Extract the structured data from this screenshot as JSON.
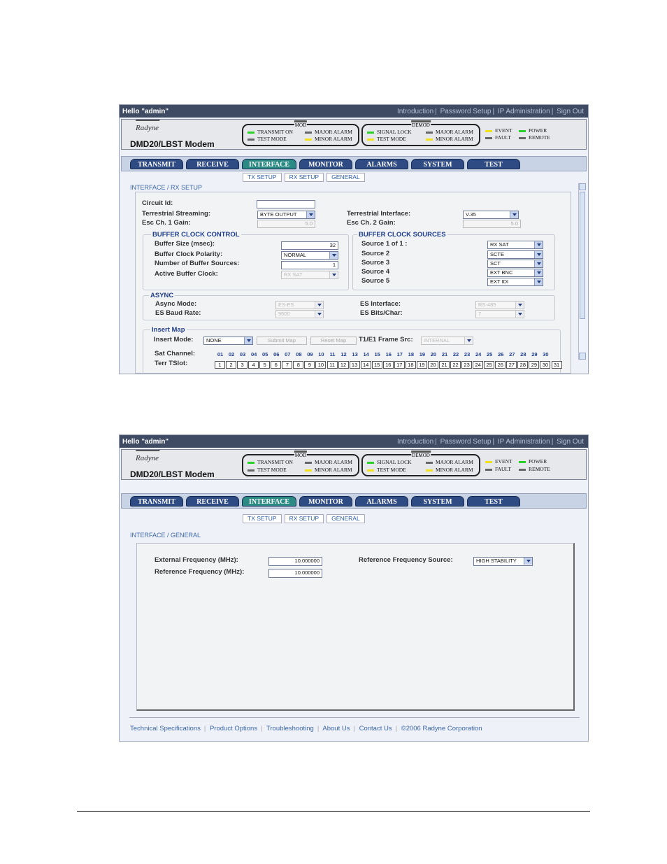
{
  "header": {
    "greeting": "Hello \"admin\"",
    "links": [
      "Introduction",
      "Password Setup",
      "IP Administration",
      "Sign Out"
    ],
    "logo": "RADYNE",
    "model": "DMD20/LBST Modem",
    "mod_label": "MOD",
    "demod_label": "DEMOD",
    "mod_leds": [
      "TRANSMIT ON",
      "TEST MODE",
      "MAJOR ALARM",
      "MINOR ALARM"
    ],
    "demod_leds": [
      "SIGNAL LOCK",
      "TEST MODE",
      "MAJOR ALARM",
      "MINOR ALARM"
    ],
    "sys_leds": [
      "EVENT",
      "FAULT",
      "POWER",
      "REMOTE"
    ],
    "colors": {
      "green": "#2bd12b",
      "yellow": "#f2e21b",
      "gray": "#666666"
    }
  },
  "tabs": [
    "TRANSMIT",
    "RECEIVE",
    "INTERFACE",
    "MONITOR",
    "ALARMS",
    "SYSTEM",
    "TEST"
  ],
  "active_tab": "INTERFACE",
  "subtabs": [
    "TX SETUP",
    "RX SETUP",
    "GENERAL"
  ],
  "screen1": {
    "breadcrumb": "INTERFACE / RX SETUP",
    "circuit_id_label": "Circuit Id:",
    "circuit_id_value": "",
    "terr_streaming_label": "Terrestrial Streaming:",
    "terr_streaming_value": "BYTE OUTPUT",
    "esc1_label": "Esc Ch. 1 Gain:",
    "esc1_value": "5.0",
    "terr_interface_label": "Terrestrial Interface:",
    "terr_interface_value": "V.35",
    "esc2_label": "Esc Ch. 2 Gain:",
    "esc2_value": "5.0",
    "buffer_control": {
      "title": "BUFFER CLOCK CONTROL",
      "size_label": "Buffer Size (msec):",
      "size_value": "32",
      "polarity_label": "Buffer Clock Polarity:",
      "polarity_value": "NORMAL",
      "num_sources_label": "Number of Buffer Sources:",
      "num_sources_value": "1",
      "active_label": "Active Buffer Clock:",
      "active_value": "RX SAT"
    },
    "buffer_sources": {
      "title": "BUFFER CLOCK SOURCES",
      "labels": [
        "Source 1 of 1 :",
        "Source 2",
        "Source 3",
        "Source 4",
        "Source 5"
      ],
      "values": [
        "RX SAT",
        "SCTE",
        "SCT",
        "EXT BNC",
        "EXT IDI"
      ]
    },
    "async": {
      "title": "ASYNC",
      "mode_label": "Async Mode:",
      "mode_value": "ES-ES",
      "baud_label": "ES Baud Rate:",
      "baud_value": "9600",
      "iface_label": "ES Interface:",
      "iface_value": "RS-485",
      "bits_label": "ES Bits/Char:",
      "bits_value": "7"
    },
    "insert_map": {
      "title": "Insert Map",
      "mode_label": "Insert Mode:",
      "mode_value": "NONE",
      "submit": "Submit Map",
      "reset": "Reset Map",
      "frame_label": "T1/E1 Frame Src:",
      "frame_value": "INTERNAL",
      "sat_label": "Sat Channel:",
      "terr_label": "Terr TSlot:",
      "sat_channels": [
        "01",
        "02",
        "03",
        "04",
        "05",
        "06",
        "07",
        "08",
        "09",
        "10",
        "11",
        "12",
        "13",
        "14",
        "15",
        "16",
        "17",
        "18",
        "19",
        "20",
        "21",
        "22",
        "23",
        "24",
        "25",
        "26",
        "27",
        "28",
        "29",
        "30"
      ],
      "terr_slots": [
        "1",
        "2",
        "3",
        "4",
        "5",
        "6",
        "7",
        "8",
        "9",
        "10",
        "11",
        "12",
        "13",
        "14",
        "15",
        "16",
        "17",
        "18",
        "19",
        "20",
        "21",
        "22",
        "23",
        "24",
        "25",
        "26",
        "27",
        "28",
        "29",
        "30",
        "31"
      ]
    }
  },
  "screen2": {
    "breadcrumb": "INTERFACE / GENERAL",
    "ext_freq_label": "External Frequency (MHz):",
    "ext_freq_value": "10.000000",
    "ref_freq_label": "Reference Frequency (MHz):",
    "ref_freq_value": "10.000000",
    "ref_src_label": "Reference Frequency Source:",
    "ref_src_value": "HIGH STABILITY"
  },
  "footer": [
    "Technical Specifications",
    "Product Options",
    "Troubleshooting",
    "About Us",
    "Contact Us",
    "©2006 Radyne Corporation"
  ]
}
